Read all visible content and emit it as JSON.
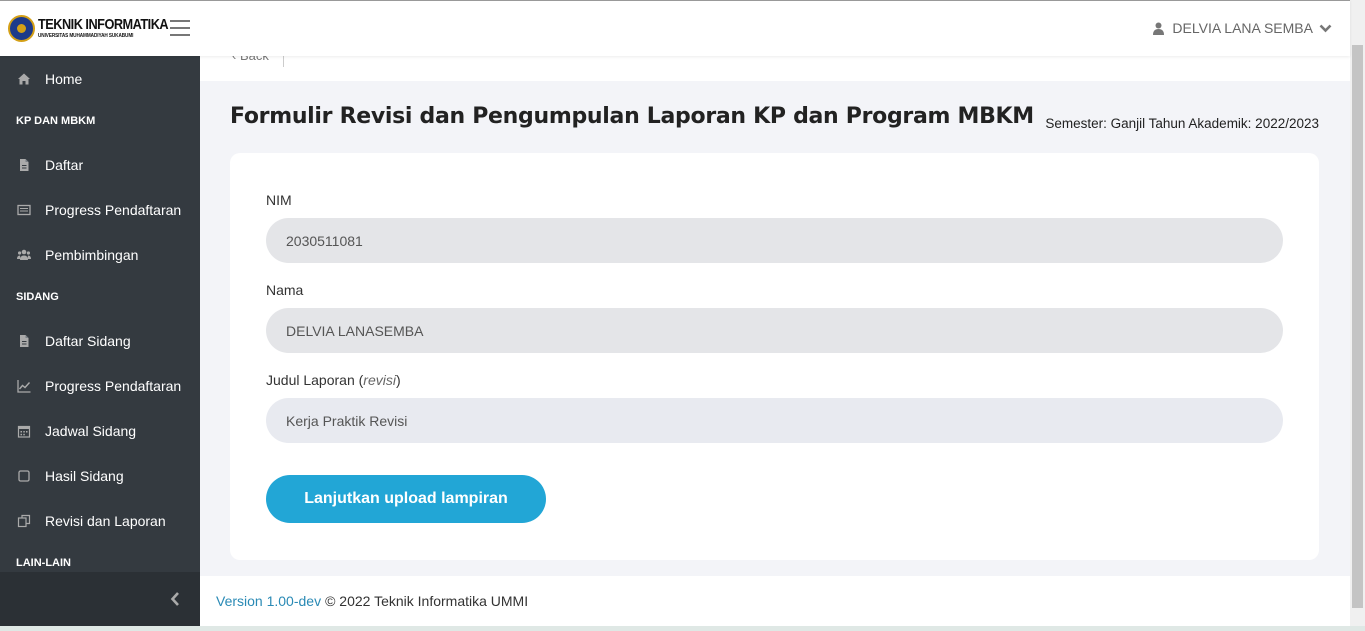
{
  "header": {
    "logo_title": "TEKNIK INFORMATIKA",
    "logo_subtitle": "UNIVERSITAS MUHAMMADIYAH SUKABUMI",
    "user_name": "DELVIA LANA SEMBA"
  },
  "sidebar": {
    "home": "Home",
    "section_kp": "KP DAN MBKM",
    "kp_items": [
      "Daftar",
      "Progress Pendaftaran",
      "Pembimbingan"
    ],
    "section_sidang": "SIDANG",
    "sidang_items": [
      "Daftar Sidang",
      "Progress Pendaftaran",
      "Jadwal Sidang",
      "Hasil Sidang",
      "Revisi dan Laporan"
    ],
    "section_lain": "LAIN-LAIN"
  },
  "main": {
    "tab_fragment": "‹ Back",
    "title": "Formulir Revisi dan Pengumpulan Laporan KP dan Program MBKM",
    "semester": "Semester: Ganjil Tahun Akademik: 2022/2023",
    "form": {
      "nim_label": "NIM",
      "nim_value": "2030511081",
      "nama_label": "Nama",
      "nama_value": "DELVIA LANASEMBA",
      "judul_label": "Judul Laporan (",
      "judul_label_em": "revisi",
      "judul_label_end": ")",
      "judul_value": "Kerja Praktik Revisi",
      "submit_label": "Lanjutkan upload lampiran"
    }
  },
  "footer": {
    "version": "Version 1.00-dev",
    "copyright": "© 2022 Teknik Informatika UMMI"
  },
  "colors": {
    "sidebar_bg": "#343a40",
    "accent": "#22a6d6",
    "link": "#2a8ab5"
  }
}
